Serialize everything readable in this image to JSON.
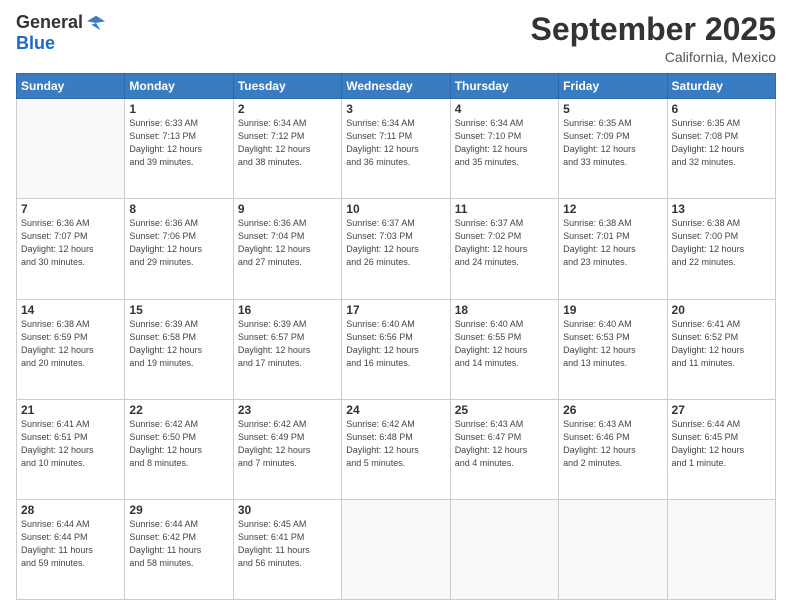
{
  "header": {
    "logo_general": "General",
    "logo_blue": "Blue",
    "month_title": "September 2025",
    "location": "California, Mexico"
  },
  "days_of_week": [
    "Sunday",
    "Monday",
    "Tuesday",
    "Wednesday",
    "Thursday",
    "Friday",
    "Saturday"
  ],
  "weeks": [
    [
      {
        "day": "",
        "info": ""
      },
      {
        "day": "1",
        "info": "Sunrise: 6:33 AM\nSunset: 7:13 PM\nDaylight: 12 hours\nand 39 minutes."
      },
      {
        "day": "2",
        "info": "Sunrise: 6:34 AM\nSunset: 7:12 PM\nDaylight: 12 hours\nand 38 minutes."
      },
      {
        "day": "3",
        "info": "Sunrise: 6:34 AM\nSunset: 7:11 PM\nDaylight: 12 hours\nand 36 minutes."
      },
      {
        "day": "4",
        "info": "Sunrise: 6:34 AM\nSunset: 7:10 PM\nDaylight: 12 hours\nand 35 minutes."
      },
      {
        "day": "5",
        "info": "Sunrise: 6:35 AM\nSunset: 7:09 PM\nDaylight: 12 hours\nand 33 minutes."
      },
      {
        "day": "6",
        "info": "Sunrise: 6:35 AM\nSunset: 7:08 PM\nDaylight: 12 hours\nand 32 minutes."
      }
    ],
    [
      {
        "day": "7",
        "info": "Sunrise: 6:36 AM\nSunset: 7:07 PM\nDaylight: 12 hours\nand 30 minutes."
      },
      {
        "day": "8",
        "info": "Sunrise: 6:36 AM\nSunset: 7:06 PM\nDaylight: 12 hours\nand 29 minutes."
      },
      {
        "day": "9",
        "info": "Sunrise: 6:36 AM\nSunset: 7:04 PM\nDaylight: 12 hours\nand 27 minutes."
      },
      {
        "day": "10",
        "info": "Sunrise: 6:37 AM\nSunset: 7:03 PM\nDaylight: 12 hours\nand 26 minutes."
      },
      {
        "day": "11",
        "info": "Sunrise: 6:37 AM\nSunset: 7:02 PM\nDaylight: 12 hours\nand 24 minutes."
      },
      {
        "day": "12",
        "info": "Sunrise: 6:38 AM\nSunset: 7:01 PM\nDaylight: 12 hours\nand 23 minutes."
      },
      {
        "day": "13",
        "info": "Sunrise: 6:38 AM\nSunset: 7:00 PM\nDaylight: 12 hours\nand 22 minutes."
      }
    ],
    [
      {
        "day": "14",
        "info": "Sunrise: 6:38 AM\nSunset: 6:59 PM\nDaylight: 12 hours\nand 20 minutes."
      },
      {
        "day": "15",
        "info": "Sunrise: 6:39 AM\nSunset: 6:58 PM\nDaylight: 12 hours\nand 19 minutes."
      },
      {
        "day": "16",
        "info": "Sunrise: 6:39 AM\nSunset: 6:57 PM\nDaylight: 12 hours\nand 17 minutes."
      },
      {
        "day": "17",
        "info": "Sunrise: 6:40 AM\nSunset: 6:56 PM\nDaylight: 12 hours\nand 16 minutes."
      },
      {
        "day": "18",
        "info": "Sunrise: 6:40 AM\nSunset: 6:55 PM\nDaylight: 12 hours\nand 14 minutes."
      },
      {
        "day": "19",
        "info": "Sunrise: 6:40 AM\nSunset: 6:53 PM\nDaylight: 12 hours\nand 13 minutes."
      },
      {
        "day": "20",
        "info": "Sunrise: 6:41 AM\nSunset: 6:52 PM\nDaylight: 12 hours\nand 11 minutes."
      }
    ],
    [
      {
        "day": "21",
        "info": "Sunrise: 6:41 AM\nSunset: 6:51 PM\nDaylight: 12 hours\nand 10 minutes."
      },
      {
        "day": "22",
        "info": "Sunrise: 6:42 AM\nSunset: 6:50 PM\nDaylight: 12 hours\nand 8 minutes."
      },
      {
        "day": "23",
        "info": "Sunrise: 6:42 AM\nSunset: 6:49 PM\nDaylight: 12 hours\nand 7 minutes."
      },
      {
        "day": "24",
        "info": "Sunrise: 6:42 AM\nSunset: 6:48 PM\nDaylight: 12 hours\nand 5 minutes."
      },
      {
        "day": "25",
        "info": "Sunrise: 6:43 AM\nSunset: 6:47 PM\nDaylight: 12 hours\nand 4 minutes."
      },
      {
        "day": "26",
        "info": "Sunrise: 6:43 AM\nSunset: 6:46 PM\nDaylight: 12 hours\nand 2 minutes."
      },
      {
        "day": "27",
        "info": "Sunrise: 6:44 AM\nSunset: 6:45 PM\nDaylight: 12 hours\nand 1 minute."
      }
    ],
    [
      {
        "day": "28",
        "info": "Sunrise: 6:44 AM\nSunset: 6:44 PM\nDaylight: 11 hours\nand 59 minutes."
      },
      {
        "day": "29",
        "info": "Sunrise: 6:44 AM\nSunset: 6:42 PM\nDaylight: 11 hours\nand 58 minutes."
      },
      {
        "day": "30",
        "info": "Sunrise: 6:45 AM\nSunset: 6:41 PM\nDaylight: 11 hours\nand 56 minutes."
      },
      {
        "day": "",
        "info": ""
      },
      {
        "day": "",
        "info": ""
      },
      {
        "day": "",
        "info": ""
      },
      {
        "day": "",
        "info": ""
      }
    ]
  ]
}
